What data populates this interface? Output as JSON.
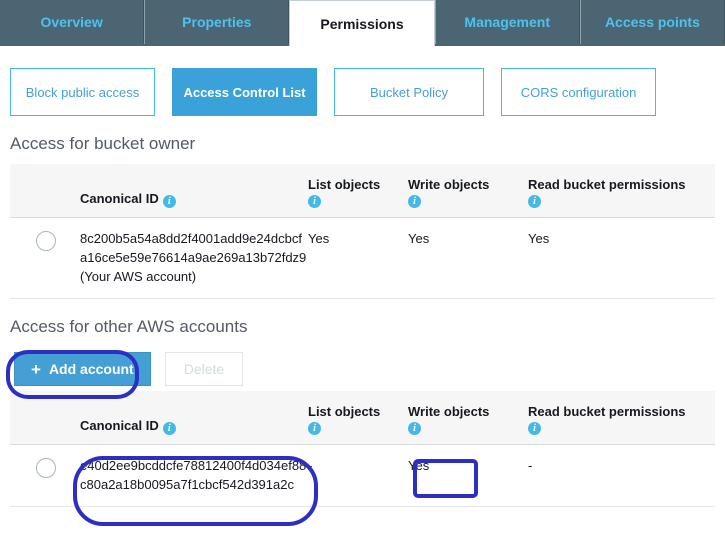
{
  "tabs": [
    {
      "label": "Overview",
      "active": false
    },
    {
      "label": "Properties",
      "active": false
    },
    {
      "label": "Permissions",
      "active": true
    },
    {
      "label": "Management",
      "active": false
    },
    {
      "label": "Access points",
      "active": false
    }
  ],
  "subtabs": [
    {
      "label": "Block public access",
      "selected": false
    },
    {
      "label": "Access Control List",
      "selected": true
    },
    {
      "label": "Bucket Policy",
      "selected": false
    },
    {
      "label": "CORS configuration",
      "selected": false
    }
  ],
  "sections": {
    "owner": {
      "title": "Access for bucket owner",
      "columns": {
        "canonical_id": "Canonical ID",
        "list_objects": "List objects",
        "write_objects": "Write objects",
        "read_bucket_permissions": "Read bucket permissions"
      },
      "rows": [
        {
          "canonical_id": "8c200b5a54a8dd2f4001add9e24dcbcfa16ce5e59e76614a9ae269a13b72fdz9 (Your AWS account)",
          "list_objects": "Yes",
          "write_objects": "Yes",
          "read_bucket_permissions": "Yes"
        }
      ]
    },
    "others": {
      "title": "Access for other AWS accounts",
      "add_account_label": "Add account",
      "add_account_plus": "+",
      "delete_label": "Delete",
      "columns": {
        "canonical_id": "Canonical ID",
        "list_objects": "List objects",
        "write_objects": "Write objects",
        "read_bucket_permissions": "Read bucket permissions"
      },
      "rows": [
        {
          "canonical_id": "e40d2ee9bcddcfe78812400f4d034ef88c80a2a18b0095a7f1cbcf542d391a2c",
          "list_objects": "-",
          "write_objects": "Yes",
          "read_bucket_permissions": "-"
        }
      ]
    }
  },
  "icons": {
    "info": "i"
  },
  "colors": {
    "tabstrip_bg": "#4c6572",
    "tab_link": "#4ec2ef",
    "accent_blue": "#3aa2d9",
    "annotation": "#2d2fc4",
    "header_bg": "#f6f6f6"
  }
}
